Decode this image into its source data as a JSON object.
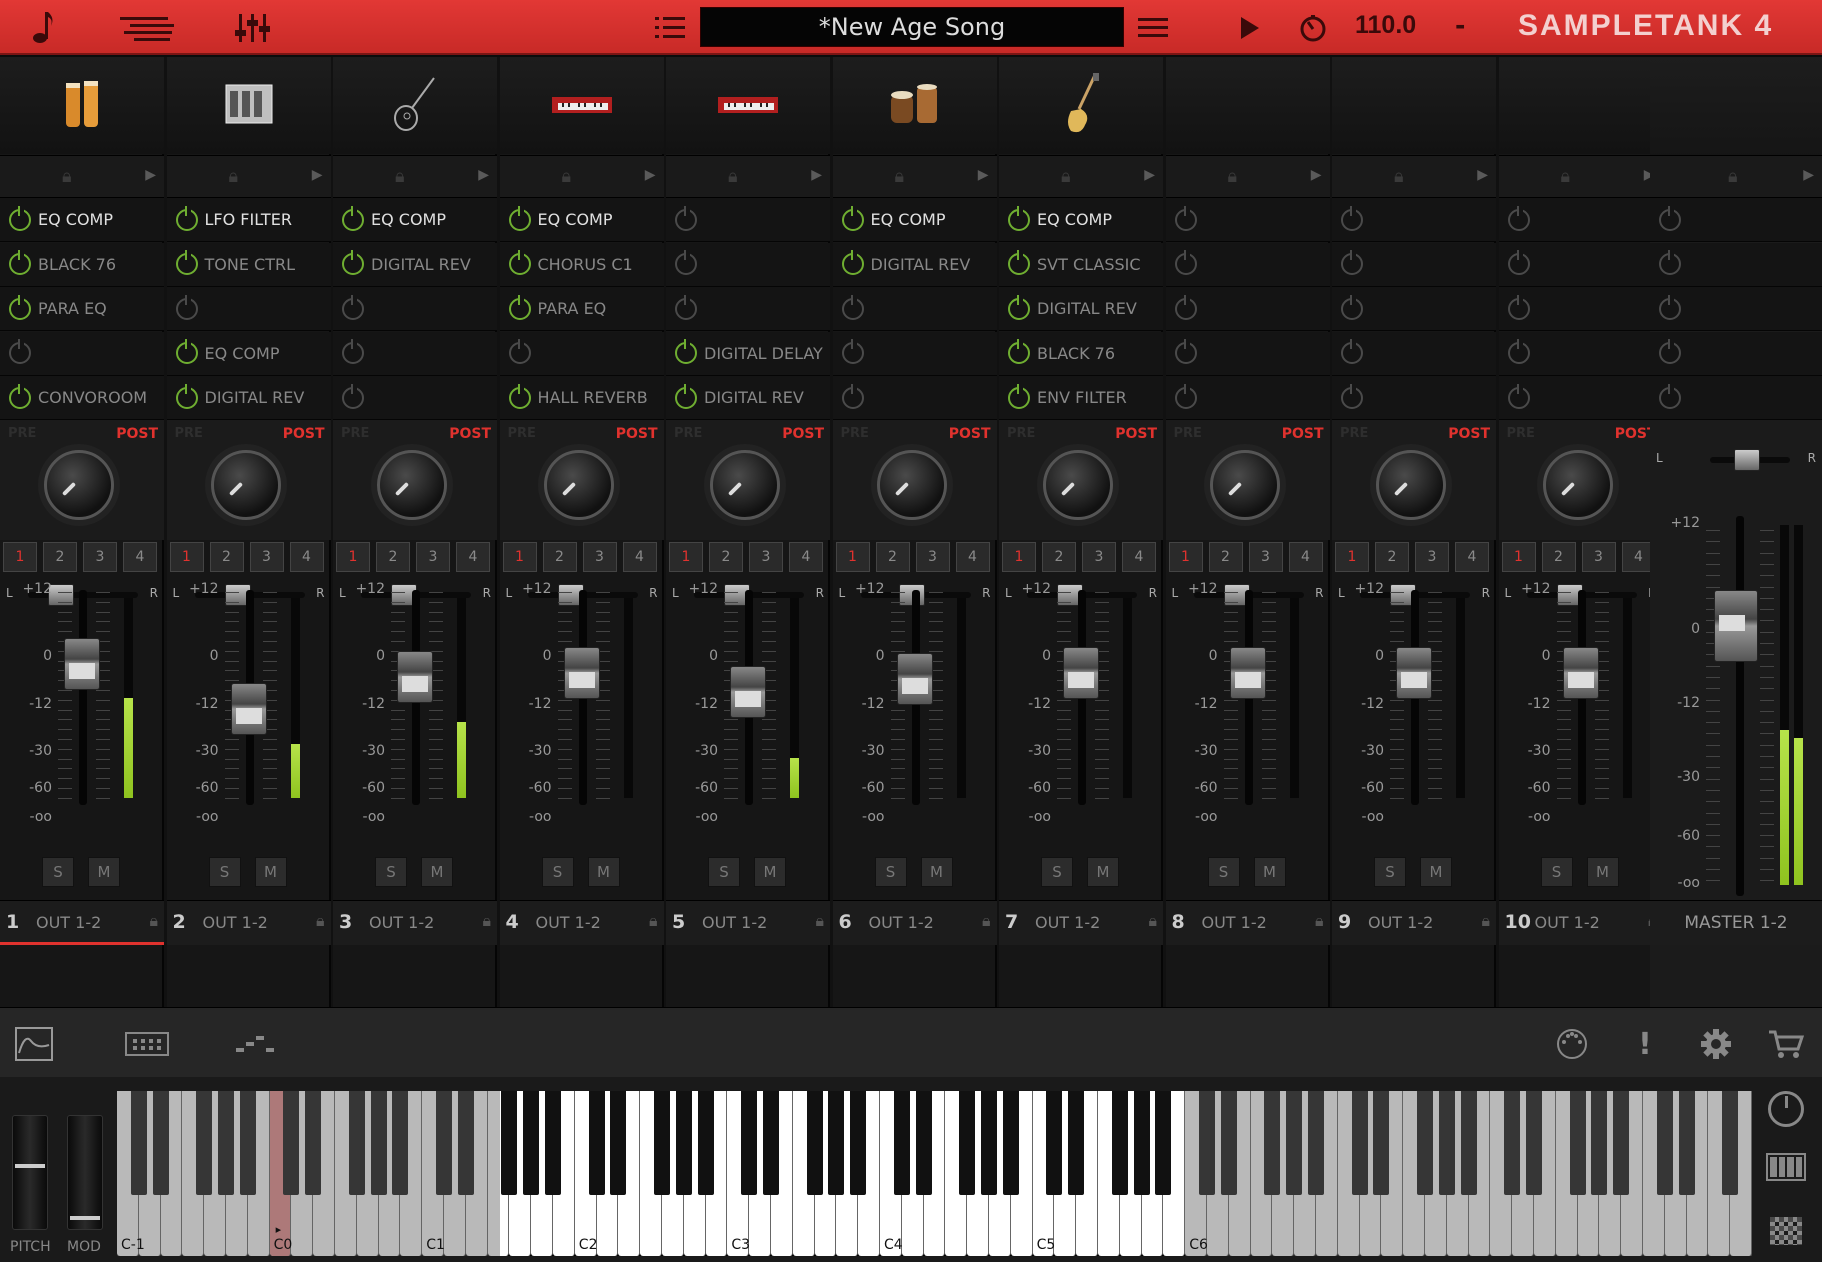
{
  "app": {
    "title": "SAMPLETANK 4",
    "song_name": "*New Age Song",
    "tempo": "110.0",
    "tempo_dash": "-"
  },
  "colors": {
    "accent": "#e23835",
    "active_power": "#6fae31",
    "meter": "#9bd12a"
  },
  "toolbar_icons": [
    "music-note-icon",
    "song-list-icon",
    "mixer-icon",
    "playlist-icon",
    "menu-icon",
    "play-icon",
    "metronome-icon"
  ],
  "channels": [
    {
      "num": "1",
      "out": "OUT 1-2",
      "instrument": "congas",
      "fx": [
        {
          "name": "EQ COMP",
          "on": true,
          "hi": true
        },
        {
          "name": "BLACK 76",
          "on": true,
          "hi": false
        },
        {
          "name": "PARA EQ",
          "on": true,
          "hi": false
        },
        {
          "name": "",
          "on": false,
          "hi": false
        },
        {
          "name": "CONVOROOM",
          "on": true,
          "hi": false
        }
      ],
      "fader": 0.73,
      "meter": 0.5,
      "selected": true
    },
    {
      "num": "2",
      "out": "OUT 1-2",
      "instrument": "keyboard-rack",
      "fx": [
        {
          "name": "LFO FILTER",
          "on": true,
          "hi": true
        },
        {
          "name": "TONE CTRL",
          "on": true,
          "hi": false
        },
        {
          "name": "",
          "on": false,
          "hi": false
        },
        {
          "name": "EQ COMP",
          "on": true,
          "hi": false
        },
        {
          "name": "DIGITAL REV",
          "on": true,
          "hi": false
        }
      ],
      "fader": 0.52,
      "meter": 0.27,
      "selected": false
    },
    {
      "num": "3",
      "out": "OUT 1-2",
      "instrument": "acoustic-guitar",
      "fx": [
        {
          "name": "EQ COMP",
          "on": true,
          "hi": true
        },
        {
          "name": "DIGITAL REV",
          "on": true,
          "hi": false
        },
        {
          "name": "",
          "on": false,
          "hi": false
        },
        {
          "name": "",
          "on": false,
          "hi": false
        },
        {
          "name": "",
          "on": false,
          "hi": false
        }
      ],
      "fader": 0.67,
      "meter": 0.38,
      "selected": false
    },
    {
      "num": "4",
      "out": "OUT 1-2",
      "instrument": "synth-keyboard",
      "fx": [
        {
          "name": "EQ COMP",
          "on": true,
          "hi": true
        },
        {
          "name": "CHORUS C1",
          "on": true,
          "hi": false
        },
        {
          "name": "PARA EQ",
          "on": true,
          "hi": false
        },
        {
          "name": "",
          "on": false,
          "hi": false
        },
        {
          "name": "HALL REVERB",
          "on": true,
          "hi": false
        }
      ],
      "fader": 0.69,
      "meter": 0.0,
      "selected": false
    },
    {
      "num": "5",
      "out": "OUT 1-2",
      "instrument": "synth-keyboard",
      "fx": [
        {
          "name": "",
          "on": false,
          "hi": false
        },
        {
          "name": "",
          "on": false,
          "hi": false
        },
        {
          "name": "",
          "on": false,
          "hi": false
        },
        {
          "name": "DIGITAL DELAY",
          "on": true,
          "hi": false
        },
        {
          "name": "DIGITAL REV",
          "on": true,
          "hi": false
        }
      ],
      "fader": 0.6,
      "meter": 0.2,
      "selected": false
    },
    {
      "num": "6",
      "out": "OUT 1-2",
      "instrument": "tabla",
      "fx": [
        {
          "name": "EQ COMP",
          "on": true,
          "hi": true
        },
        {
          "name": "DIGITAL REV",
          "on": true,
          "hi": false
        },
        {
          "name": "",
          "on": false,
          "hi": false
        },
        {
          "name": "",
          "on": false,
          "hi": false
        },
        {
          "name": "",
          "on": false,
          "hi": false
        }
      ],
      "fader": 0.66,
      "meter": 0.0,
      "selected": false
    },
    {
      "num": "7",
      "out": "OUT 1-2",
      "instrument": "bass-guitar",
      "fx": [
        {
          "name": "EQ COMP",
          "on": true,
          "hi": true
        },
        {
          "name": "SVT CLASSIC",
          "on": true,
          "hi": false
        },
        {
          "name": "DIGITAL REV",
          "on": true,
          "hi": false
        },
        {
          "name": "BLACK 76",
          "on": true,
          "hi": false
        },
        {
          "name": "ENV FILTER",
          "on": true,
          "hi": false
        }
      ],
      "fader": 0.69,
      "meter": 0.0,
      "selected": false
    },
    {
      "num": "8",
      "out": "OUT 1-2",
      "instrument": "",
      "fx": [
        {
          "name": "",
          "on": false,
          "hi": false
        },
        {
          "name": "",
          "on": false,
          "hi": false
        },
        {
          "name": "",
          "on": false,
          "hi": false
        },
        {
          "name": "",
          "on": false,
          "hi": false
        },
        {
          "name": "",
          "on": false,
          "hi": false
        }
      ],
      "fader": 0.69,
      "meter": 0.0,
      "selected": false
    },
    {
      "num": "9",
      "out": "OUT 1-2",
      "instrument": "",
      "fx": [
        {
          "name": "",
          "on": false,
          "hi": false
        },
        {
          "name": "",
          "on": false,
          "hi": false
        },
        {
          "name": "",
          "on": false,
          "hi": false
        },
        {
          "name": "",
          "on": false,
          "hi": false
        },
        {
          "name": "",
          "on": false,
          "hi": false
        }
      ],
      "fader": 0.69,
      "meter": 0.0,
      "selected": false
    },
    {
      "num": "10",
      "out": "OUT 1-2",
      "instrument": "",
      "fx": [
        {
          "name": "",
          "on": false,
          "hi": false
        },
        {
          "name": "",
          "on": false,
          "hi": false
        },
        {
          "name": "",
          "on": false,
          "hi": false
        },
        {
          "name": "",
          "on": false,
          "hi": false
        },
        {
          "name": "",
          "on": false,
          "hi": false
        }
      ],
      "fader": 0.69,
      "meter": 0.0,
      "selected": false
    }
  ],
  "strip_labels": {
    "pre": "PRE",
    "post": "POST",
    "pan_l": "L",
    "pan_r": "R",
    "solo": "S",
    "mute": "M",
    "buses": [
      "1",
      "2",
      "3",
      "4"
    ],
    "scale": [
      "+12",
      "0",
      "-12",
      "-30",
      "-60",
      "-oo"
    ]
  },
  "master": {
    "label": "MASTER 1-2",
    "scale": [
      "+12",
      "0",
      "-12",
      "-30",
      "-60",
      "-oo"
    ],
    "fader": 0.78,
    "meter_l": 0.62,
    "meter_r": 0.59
  },
  "keyboard": {
    "pitch_label": "PITCH",
    "mod_label": "MOD",
    "octave_labels": [
      "C-1",
      "C0",
      "C1",
      "C2",
      "C3",
      "C4",
      "C5",
      "C6"
    ],
    "pressed_key": "C0",
    "marker": "▸"
  },
  "bottom_icons": [
    "envelope-icon",
    "pads-icon",
    "arpeggiator-icon",
    "midi-learn-icon",
    "alert-icon",
    "settings-icon",
    "cart-icon"
  ]
}
